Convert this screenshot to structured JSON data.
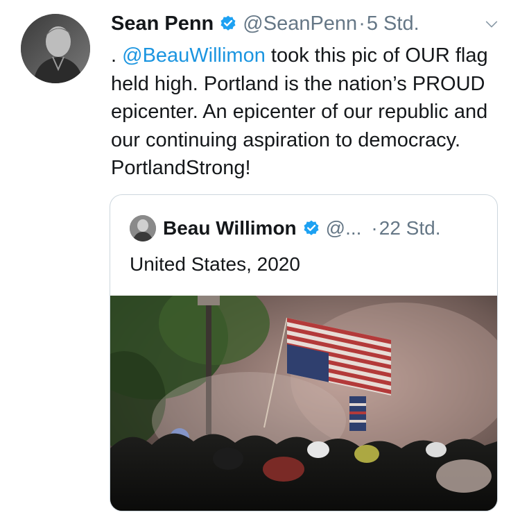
{
  "tweet": {
    "author_name": "Sean Penn",
    "handle": "@SeanPenn",
    "separator": "·",
    "time": "5 Std.",
    "text_prefix": ". ",
    "mention": "@BeauWillimon",
    "text_body": " took this pic of OUR flag held high. Portland is the nation’s PROUD epicenter. An epicenter of our republic and our continuing aspiration to democracy. PortlandStrong!"
  },
  "quote": {
    "author_name": "Beau Willimon",
    "handle": "@...",
    "separator": "·",
    "time": "22 Std.",
    "text": "United States, 2020"
  },
  "icons": {
    "verified": "verified-badge-icon",
    "more": "chevron-down-icon"
  },
  "colors": {
    "verified": "#1da1f2",
    "mention": "#1b95e0",
    "secondary_text": "#657786",
    "border": "#ccd6dd"
  }
}
